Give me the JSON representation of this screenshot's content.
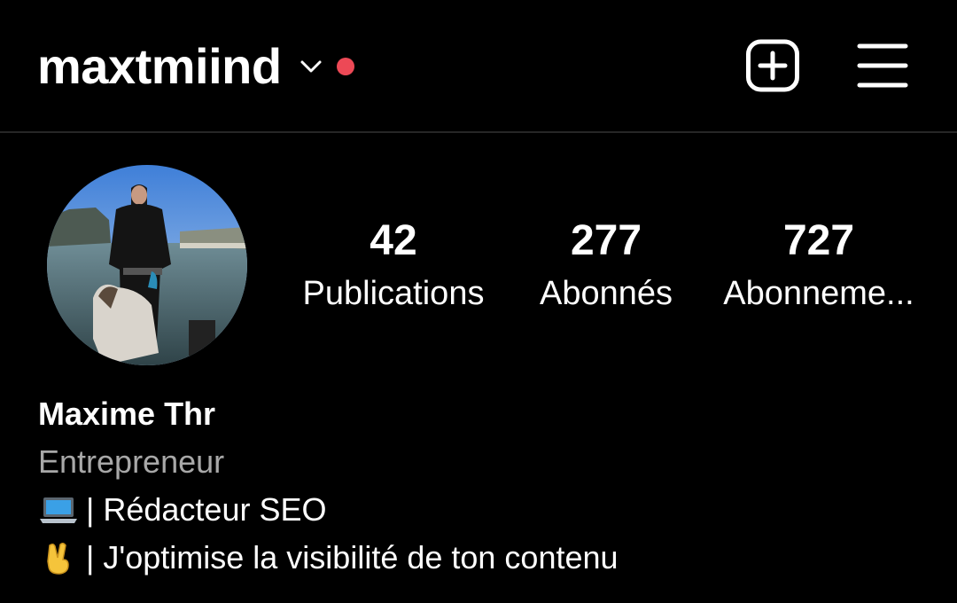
{
  "header": {
    "username": "maxtmiind",
    "live_dot_color": "#ed4956",
    "icons": [
      "chevron-down-icon",
      "new-post-icon",
      "menu-icon"
    ]
  },
  "profile": {
    "avatar": "profile-photo",
    "stats": [
      {
        "count": "42",
        "label": "Publications"
      },
      {
        "count": "277",
        "label": "Abonnés"
      },
      {
        "count": "727",
        "label": "Abonneme..."
      }
    ],
    "full_name": "Maxime Thr",
    "category": "Entrepreneur",
    "bio_lines": [
      {
        "emoji": "laptop-emoji",
        "text": "| Rédacteur SEO"
      },
      {
        "emoji": "victory-hand-emoji",
        "text": "| J'optimise la visibilité de ton contenu"
      }
    ]
  },
  "colors": {
    "background": "#000000",
    "text": "#ffffff",
    "secondary_text": "#a8a8a8",
    "divider": "#262626"
  }
}
